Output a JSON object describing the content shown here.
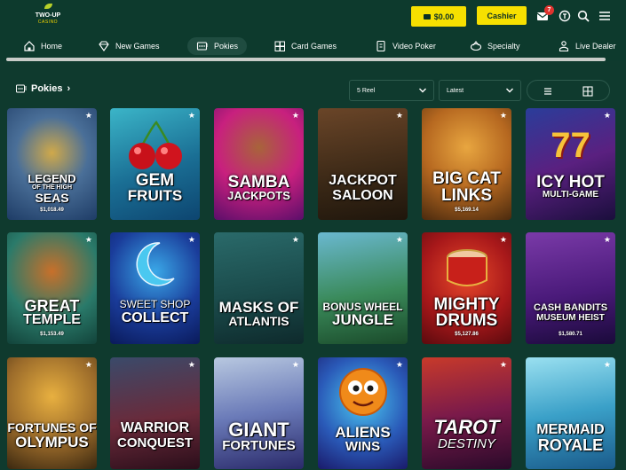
{
  "header": {
    "logo_top": "TWO-UP",
    "logo_bottom": "CASINO",
    "balance": "$0.00",
    "cashier": "Cashier",
    "mail_count": "7",
    "colors": {
      "accent": "#f6e000",
      "bg": "#0d3a2d",
      "badge": "#e0332e"
    }
  },
  "nav": {
    "items": [
      {
        "label": "Home",
        "icon": "house-icon"
      },
      {
        "label": "New Games",
        "icon": "diamond-icon"
      },
      {
        "label": "Pokies",
        "icon": "slot-machine-icon",
        "active": true
      },
      {
        "label": "Card Games",
        "icon": "cards-icon"
      },
      {
        "label": "Video Poker",
        "icon": "video-poker-icon"
      },
      {
        "label": "Specialty",
        "icon": "specialty-icon"
      },
      {
        "label": "Live Dealer",
        "icon": "dealer-icon"
      }
    ]
  },
  "section": {
    "title": "Pokies",
    "reel_filter": "5 Reel",
    "sort": "Latest"
  },
  "games": [
    {
      "line1": "LEGEND",
      "line2": "OF THE HIGH",
      "line3": "SEAS",
      "jackpot": "$1,018.49"
    },
    {
      "line1": "GEM",
      "line2": "FRUITS",
      "line3": "",
      "jackpot": ""
    },
    {
      "line1": "SAMBA",
      "line2": "JACKPOTS",
      "line3": "",
      "jackpot": ""
    },
    {
      "line1": "JACKPOT",
      "line2": "SALOON",
      "line3": "",
      "jackpot": ""
    },
    {
      "line1": "BIG CAT",
      "line2": "LINKS",
      "line3": "",
      "jackpot": "$5,169.14"
    },
    {
      "line1": "ICY HOT",
      "line2": "MULTI-GAME",
      "line3": "",
      "jackpot": ""
    },
    {
      "line1": "GREAT",
      "line2": "TEMPLE",
      "line3": "",
      "jackpot": "$1,153.49"
    },
    {
      "line1": "SWEET SHOP",
      "line2": "COLLECT",
      "line3": "",
      "jackpot": ""
    },
    {
      "line1": "MASKS OF",
      "line2": "ATLANTIS",
      "line3": "",
      "jackpot": ""
    },
    {
      "line1": "BONUS WHEEL",
      "line2": "JUNGLE",
      "line3": "",
      "jackpot": ""
    },
    {
      "line1": "MIGHTY",
      "line2": "DRUMS",
      "line3": "",
      "jackpot": "$5,127.86"
    },
    {
      "line1": "CASH BANDITS",
      "line2": "MUSEUM HEIST",
      "line3": "",
      "jackpot": "$1,580.71"
    },
    {
      "line1": "FORTUNES OF",
      "line2": "OLYMPUS",
      "line3": "",
      "jackpot": ""
    },
    {
      "line1": "WARRIOR",
      "line2": "CONQUEST",
      "line3": "",
      "jackpot": ""
    },
    {
      "line1": "GIANT",
      "line2": "FORTUNES",
      "line3": "",
      "jackpot": ""
    },
    {
      "line1": "ALIENS",
      "line2": "WINS",
      "line3": "",
      "jackpot": ""
    },
    {
      "line1": "TAROT",
      "line2": "DESTINY",
      "line3": "",
      "jackpot": ""
    },
    {
      "line1": "MERMAID",
      "line2": "ROYALE",
      "line3": "",
      "jackpot": ""
    }
  ]
}
